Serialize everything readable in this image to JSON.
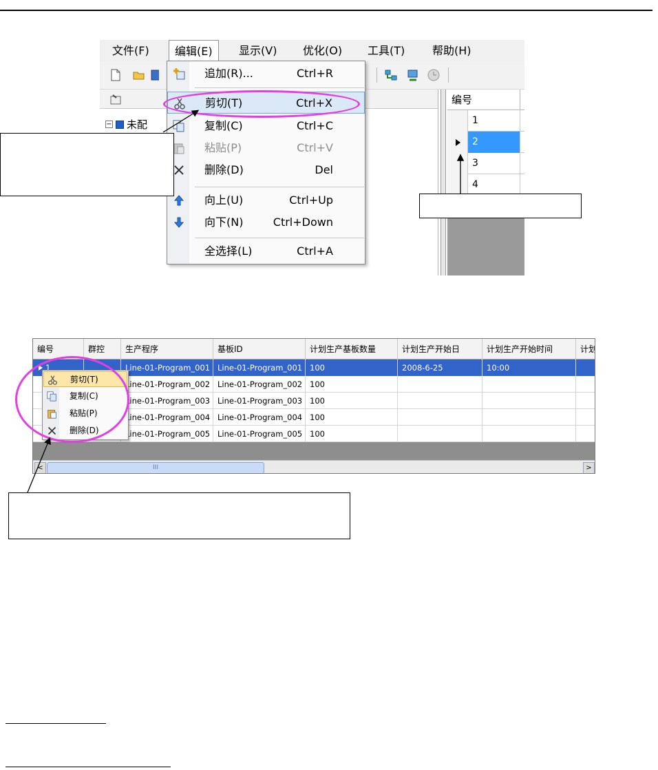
{
  "shot1": {
    "menu": [
      {
        "label": "文件(F)"
      },
      {
        "label": "编辑(E)"
      },
      {
        "label": "显示(V)"
      },
      {
        "label": "优化(O)"
      },
      {
        "label": "工具(T)"
      },
      {
        "label": "帮助(H)"
      }
    ],
    "tree_label": "未配",
    "grid_header": "编号",
    "grid_rows": [
      "1",
      "2",
      "3",
      "4"
    ],
    "dropdown": [
      {
        "label": "追加(R)...",
        "shortcut": "Ctrl+R",
        "icon": "add-icon"
      },
      {
        "label": "剪切(T)",
        "shortcut": "Ctrl+X",
        "icon": "scissors-icon"
      },
      {
        "label": "复制(C)",
        "shortcut": "Ctrl+C",
        "icon": "copy-icon"
      },
      {
        "label": "粘贴(P)",
        "shortcut": "Ctrl+V",
        "icon": "paste-icon"
      },
      {
        "label": "删除(D)",
        "shortcut": "Del",
        "icon": "delete-icon"
      },
      {
        "label": "向上(U)",
        "shortcut": "Ctrl+Up",
        "icon": "arrow-up-icon"
      },
      {
        "label": "向下(N)",
        "shortcut": "Ctrl+Down",
        "icon": "arrow-down-icon"
      },
      {
        "label": "全选择(L)",
        "shortcut": "Ctrl+A",
        "icon": "select-all-icon"
      }
    ]
  },
  "shot2": {
    "headers": [
      "编号",
      "群控",
      "生产程序",
      "基板ID",
      "计划生产基板数量",
      "计划生产开始日",
      "计划生产开始时间",
      "计划"
    ],
    "rows": [
      [
        "1",
        "",
        "Line-01-Program_001",
        "Line-01-Program_001",
        "100",
        "2008-6-25",
        "10:00",
        ""
      ],
      [
        "",
        "",
        "Line-01-Program_002",
        "Line-01-Program_002",
        "100",
        "",
        "",
        ""
      ],
      [
        "",
        "",
        "Line-01-Program_003",
        "Line-01-Program_003",
        "100",
        "",
        "",
        ""
      ],
      [
        "",
        "",
        "Line-01-Program_004",
        "Line-01-Program_004",
        "100",
        "",
        "",
        ""
      ],
      [
        "",
        "",
        "Line-01-Program_005",
        "Line-01-Program_005",
        "100",
        "",
        "",
        ""
      ]
    ],
    "context_menu": [
      {
        "label": "剪切(T)",
        "icon": "scissors-icon"
      },
      {
        "label": "复制(C)",
        "icon": "copy-icon"
      },
      {
        "label": "粘贴(P)",
        "icon": "paste-icon"
      },
      {
        "label": "删除(D)",
        "icon": "delete-icon"
      }
    ],
    "scroll_left": "<",
    "scroll_right": ">",
    "scroll_grip": "III"
  },
  "colors": {
    "highlight_ellipse": "#e23ee2",
    "selection_blue": "#3399ff",
    "selection_dark_blue": "#3163c8"
  }
}
